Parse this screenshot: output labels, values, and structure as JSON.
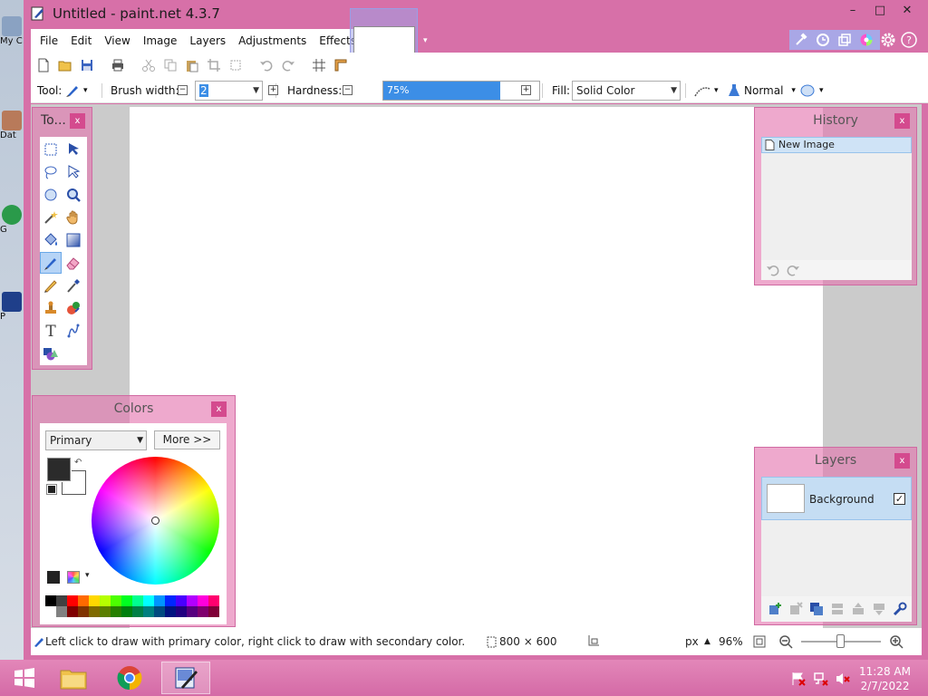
{
  "window": {
    "title": "Untitled - paint.net 4.3.7",
    "minimize_glyph": "–",
    "maximize_glyph": "□",
    "close_glyph": "✕"
  },
  "desktop": {
    "icons": [
      {
        "label": "My C",
        "icon": "computer-icon"
      },
      {
        "label": "Dat",
        "icon": "data-icon"
      },
      {
        "label": "G",
        "icon": "chrome-icon"
      },
      {
        "label": "P",
        "icon": "paintnet-icon"
      }
    ]
  },
  "menu": {
    "items": [
      "File",
      "Edit",
      "View",
      "Image",
      "Layers",
      "Adjustments",
      "Effects"
    ]
  },
  "toolbar2": {
    "tool_label": "Tool:",
    "brush_width_label": "Brush width:",
    "brush_width_value": "2",
    "hardness_label": "Hardness:",
    "hardness_value": "75%",
    "hardness_fraction": 0.75,
    "fill_label": "Fill:",
    "fill_value": "Solid Color",
    "blend_value": "Normal"
  },
  "tools_panel": {
    "title": "To...",
    "close_glyph": "x",
    "tools": [
      "rectangle-select-icon",
      "move-selection-icon",
      "lasso-select-icon",
      "move-selected-icon",
      "ellipse-select-icon",
      "zoom-icon",
      "magic-wand-icon",
      "pan-icon",
      "paint-bucket-icon",
      "gradient-icon",
      "paintbrush-icon",
      "eraser-icon",
      "pencil-icon",
      "color-picker-icon",
      "clone-stamp-icon",
      "recolor-icon",
      "text-icon",
      "line-curve-icon",
      "shapes-icon"
    ],
    "active_tool": "paintbrush-icon",
    "text_tool_glyph": "T"
  },
  "history_panel": {
    "title": "History",
    "close_glyph": "x",
    "items": [
      "New Image"
    ]
  },
  "layers_panel": {
    "title": "Layers",
    "close_glyph": "x",
    "items": [
      {
        "name": "Background",
        "visible": true
      }
    ],
    "check_glyph": "✓"
  },
  "colors_panel": {
    "title": "Colors",
    "close_glyph": "x",
    "mode_value": "Primary",
    "more_label": "More >>",
    "primary_color": "#2b2b2b",
    "secondary_color": "#ffffff",
    "palette": [
      "#000000",
      "#404040",
      "#ff0000",
      "#ff6a00",
      "#ffd800",
      "#b6ff00",
      "#4cff00",
      "#00ff21",
      "#00ff90",
      "#00ffff",
      "#0094ff",
      "#0026ff",
      "#4800ff",
      "#b200ff",
      "#ff00dc",
      "#ff006e",
      "#ffffff",
      "#808080",
      "#7f0000",
      "#7f3300",
      "#7f6a00",
      "#5b7f00",
      "#267f00",
      "#007f0e",
      "#007f46",
      "#007f7f",
      "#004a7f",
      "#00137f",
      "#21007f",
      "#57007f",
      "#7f006e",
      "#7f0037"
    ]
  },
  "status": {
    "hint": "Left click to draw with primary color, right click to draw with secondary color.",
    "size": "800 × 600",
    "units": "px",
    "zoom": "96%"
  },
  "taskbar": {
    "time": "11:28 AM",
    "date": "2/7/2022"
  }
}
